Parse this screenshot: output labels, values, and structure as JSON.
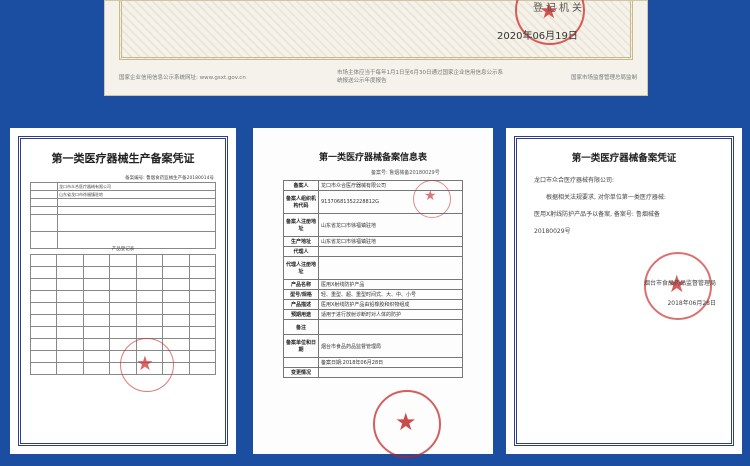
{
  "top_certificate": {
    "registration_authority": "登记机关",
    "date": "2020年06月19日",
    "footer_left": "国家企业信用信息公示系统网址: www.gsxt.gov.cn",
    "footer_middle": "市场主体应当于每年1月1日至6月30日通过国家企业信用信息公示系统报送公示年度报告",
    "footer_right": "国家市场监督管理总局监制"
  },
  "left_certificate": {
    "title": "第一类医疗器械生产备案凭证",
    "record_number": "备案编号: 鲁烟食药监械生产备20180014号",
    "company_name": "龙口市众合医疗器械有限公司",
    "address": "山东省龙口市徐福镇驻地",
    "section_label": "产品登记表"
  },
  "middle_certificate": {
    "title": "第一类医疗器械备案信息表",
    "record_number": "备案号: 鲁烟械备20180029号",
    "rows": [
      {
        "label": "备案人",
        "value": "龙口市众合医疗器械有限公司"
      },
      {
        "label": "备案人组织机构代码",
        "value": "91370681352228812G"
      },
      {
        "label": "备案人注册地址",
        "value": "山东省龙口市徐福镇驻地"
      },
      {
        "label": "生产地址",
        "value": "山东省龙口市徐福镇驻地"
      },
      {
        "label": "代理人",
        "value": ""
      },
      {
        "label": "代理人注册地址",
        "value": ""
      },
      {
        "label": "产品名称",
        "value": "医用X射线防护产品"
      },
      {
        "label": "型号/规格",
        "value": "轻、重型、超、重型时间式、大、中、小号"
      },
      {
        "label": "产品描述",
        "value": "医用X射线防护产品由铅橡胶和织物组成"
      },
      {
        "label": "预期用途",
        "value": "适用于进行放射诊断时对人体的防护"
      },
      {
        "label": "备注",
        "value": ""
      },
      {
        "label": "备案单位和日期",
        "value": "烟台市食品药品监督管理局"
      },
      {
        "label": "",
        "value": "备案日期:2018年06月28日"
      },
      {
        "label": "变更情况",
        "value": ""
      }
    ]
  },
  "right_certificate": {
    "title": "第一类医疗器械备案凭证",
    "addressee": "龙口市众合医疗器械有限公司:",
    "body_line1": "根据相关法规要求, 对你单位第一类医疗器械:",
    "body_line2": "医用X射线防护产品予以备案, 备案号: 鲁烟械备",
    "body_line3": "20180029号",
    "bureau": "烟台市食品药品监督管理局",
    "date": "2018年06月28日"
  },
  "colors": {
    "background": "#1b4ea0",
    "seal": "#cd3232",
    "frame": "#2b3f8c"
  }
}
